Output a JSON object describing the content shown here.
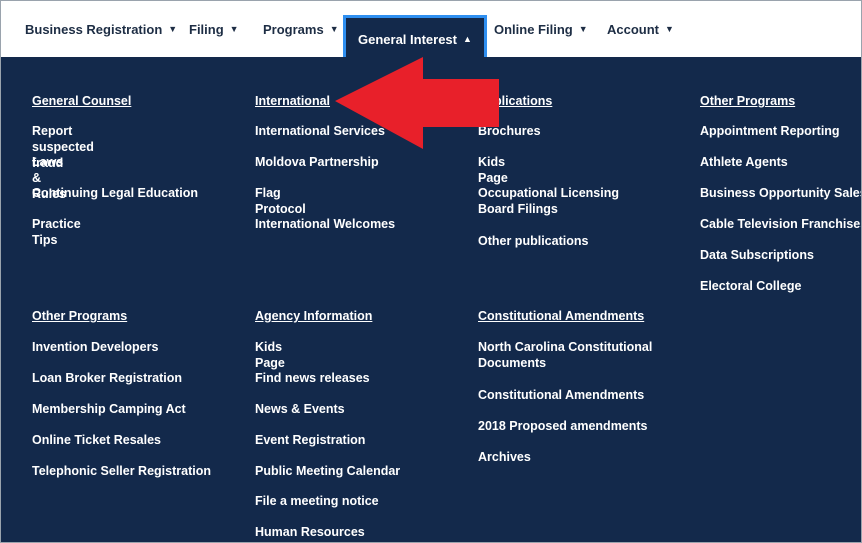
{
  "nav": {
    "items": [
      {
        "label": "Business Registration"
      },
      {
        "label": "Filing"
      },
      {
        "label": "Programs"
      },
      {
        "label": "General Interest"
      },
      {
        "label": "Online Filing"
      },
      {
        "label": "Account"
      }
    ]
  },
  "menu": {
    "general_counsel": {
      "heading": "General Counsel",
      "links": [
        "Report suspected fraud",
        "Laws & Rules",
        "Continuing Legal Education",
        "Practice Tips"
      ]
    },
    "international": {
      "heading": "International",
      "links": [
        "International Services",
        "Moldova Partnership",
        "Flag Protocol",
        "International Welcomes"
      ]
    },
    "publications": {
      "heading": "Publications",
      "links": [
        "Brochures",
        "Kids Page",
        "Occupational Licensing Board Filings",
        "Other publications"
      ]
    },
    "other_programs_1": {
      "heading": "Other Programs",
      "links": [
        "Appointment Reporting",
        "Athlete Agents",
        "Business Opportunity Sales",
        "Cable Television Franchises",
        "Data Subscriptions",
        "Electoral College"
      ]
    },
    "other_programs_2": {
      "heading": "Other Programs",
      "links": [
        "Invention Developers",
        "Loan Broker Registration",
        "Membership Camping Act",
        "Online Ticket Resales",
        "Telephonic Seller Registration"
      ]
    },
    "agency_information": {
      "heading": "Agency Information",
      "links": [
        "Kids Page",
        "Find news releases",
        "News & Events",
        "Event Registration",
        "Public Meeting Calendar",
        "File a meeting notice",
        "Human Resources"
      ]
    },
    "constitutional_amendments": {
      "heading": "Constitutional Amendments",
      "links": [
        "North Carolina Constitutional Documents",
        "Constitutional Amendments",
        "2018 Proposed amendments",
        "Archives"
      ]
    }
  },
  "colors": {
    "panel_bg": "#13294b",
    "active_border": "#2f8ff0",
    "arrow": "#e8202a"
  }
}
